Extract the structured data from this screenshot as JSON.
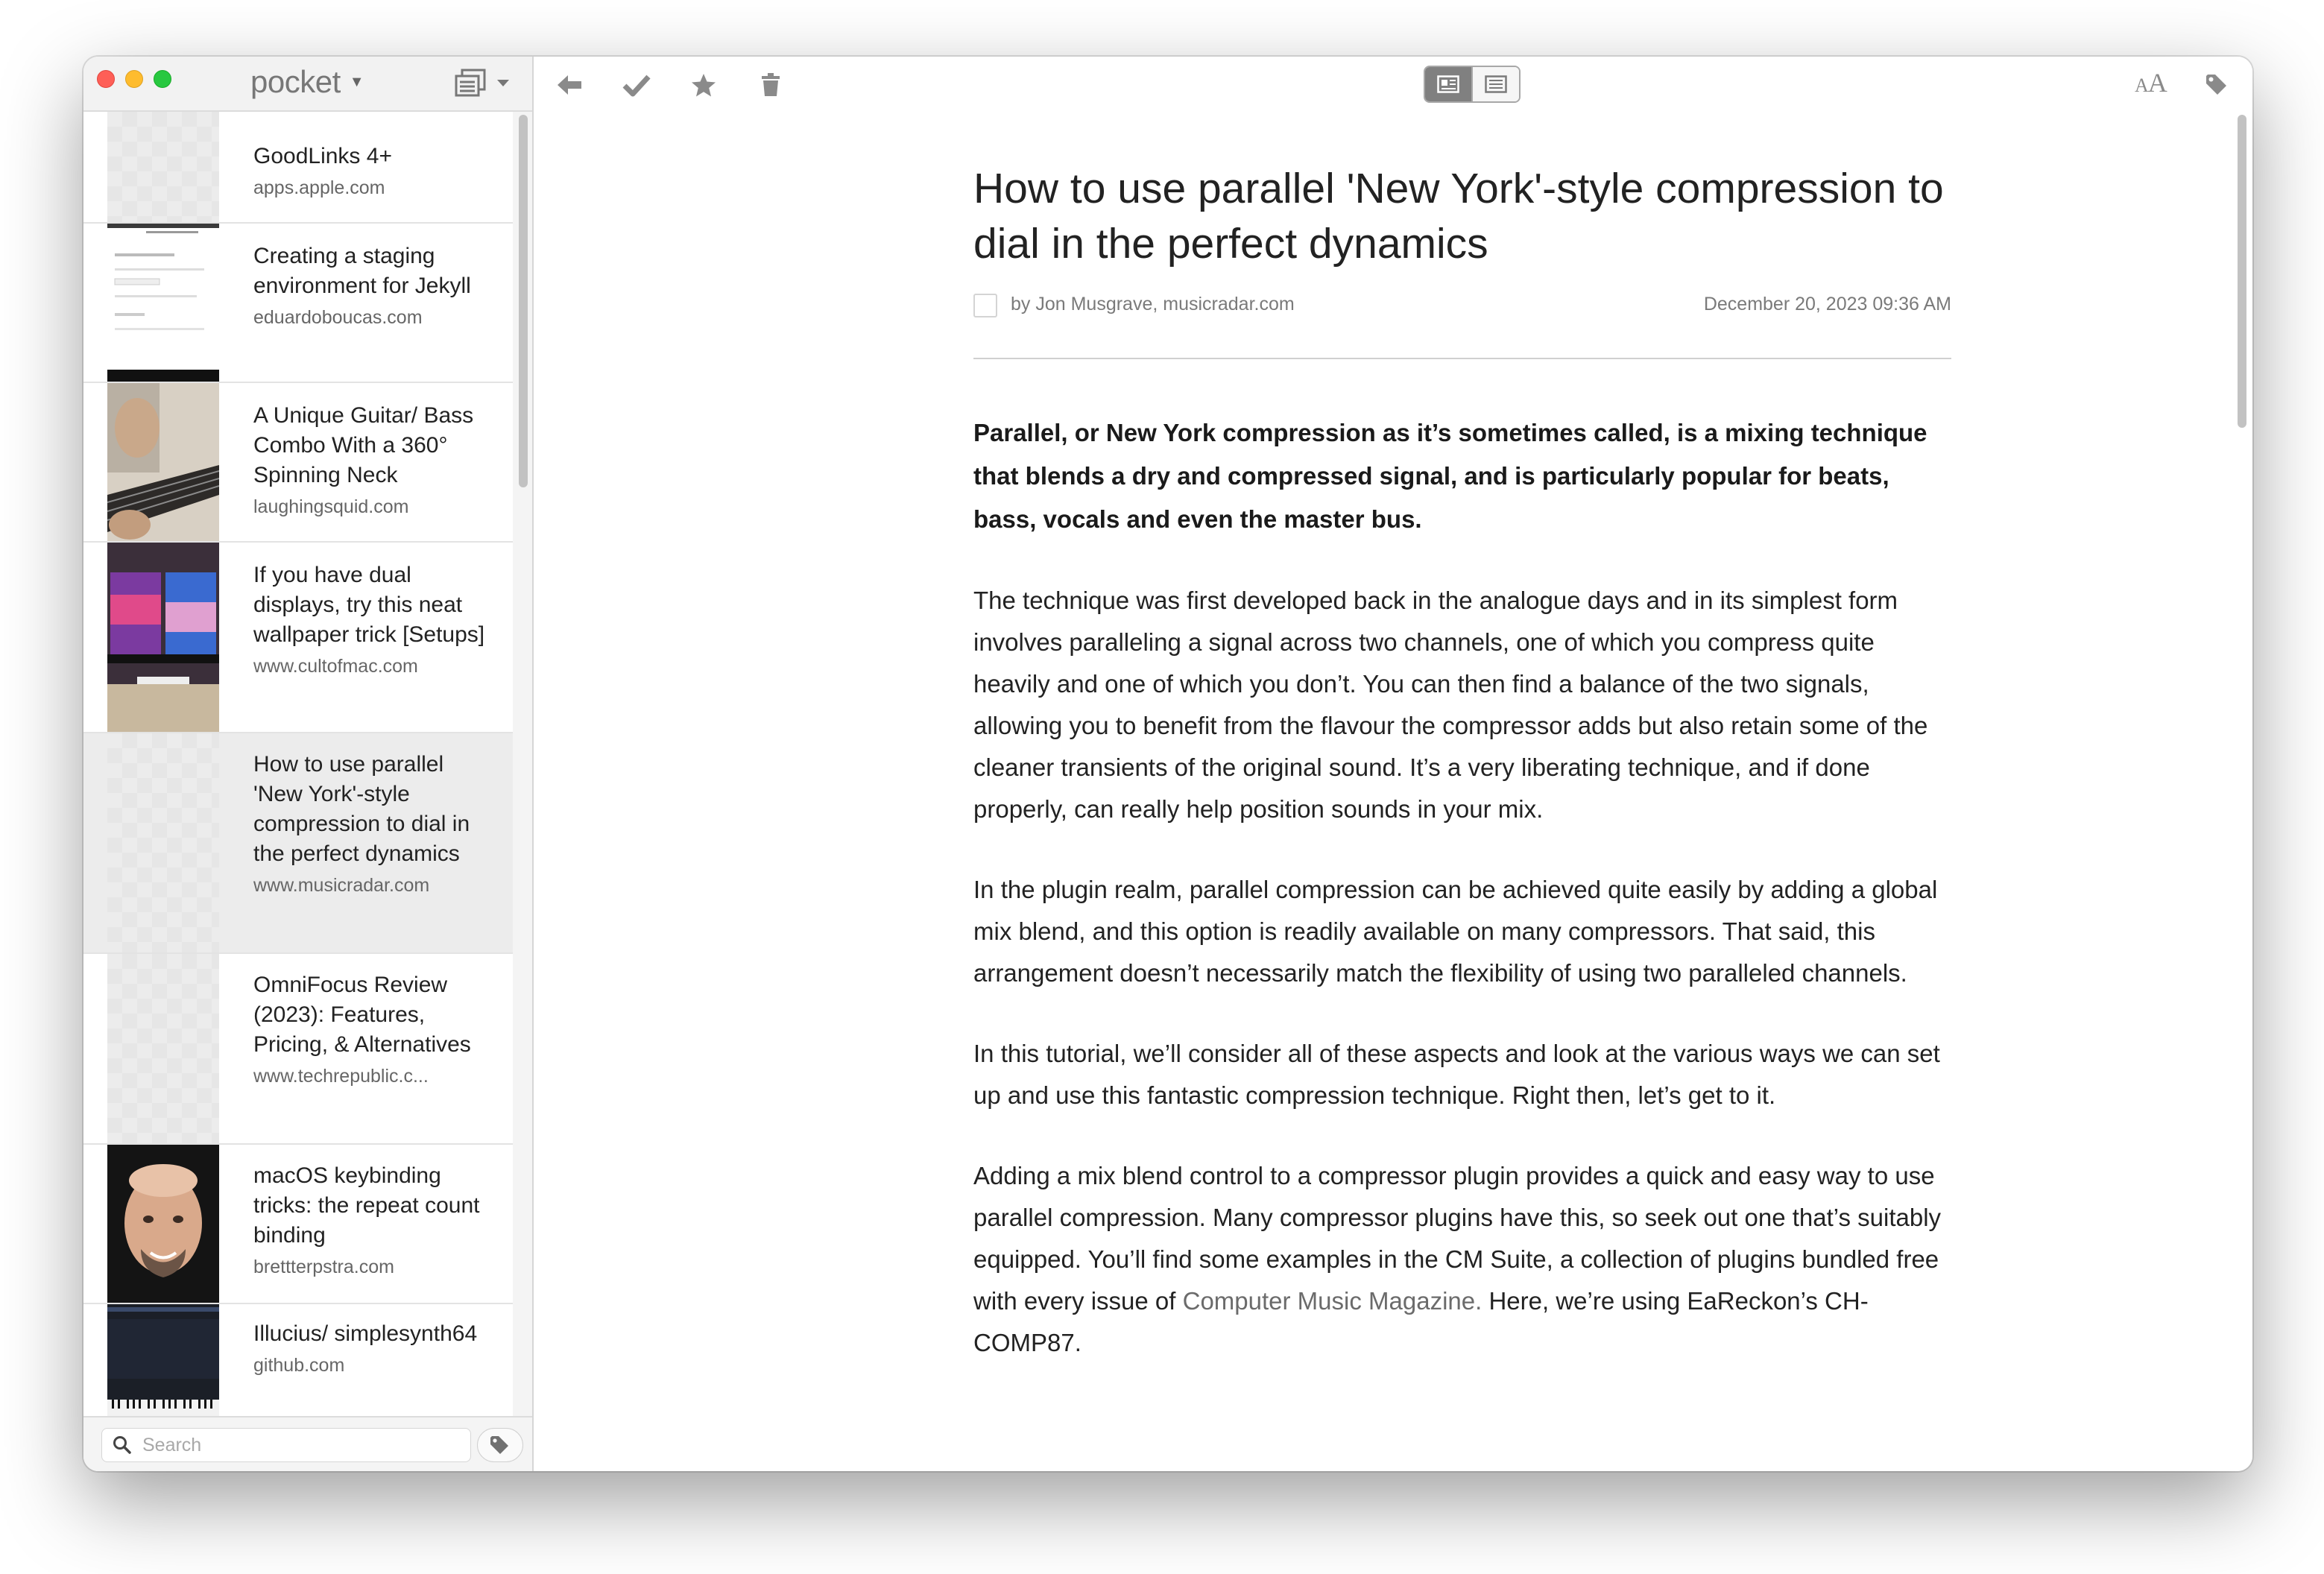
{
  "app": {
    "brand": "pocket"
  },
  "sidebar": {
    "items": [
      {
        "title": "GoodLinks 4+",
        "domain": "apps.apple.com",
        "thumb": "placeholder"
      },
      {
        "title": "Creating a staging environment for Jekyll",
        "domain": "eduardoboucas.com",
        "thumb": "web-page-screenshot"
      },
      {
        "title": "A Unique Guitar/ Bass Combo With a 360° Spinning Neck",
        "domain": "laughingsquid.com",
        "thumb": "guitar-photo"
      },
      {
        "title": "If you have dual displays, try this neat wallpaper trick [Setups]",
        "domain": "www.cultofmac.com",
        "thumb": "dual-displays-photo"
      },
      {
        "title": "How to use parallel 'New York'-style compression to dial in the perfect dynamics",
        "domain": "www.musicradar.com",
        "thumb": "placeholder",
        "selected": true
      },
      {
        "title": "OmniFocus Review (2023): Features, Pricing, & Alternatives",
        "domain": "www.techrepublic.c...",
        "thumb": "placeholder"
      },
      {
        "title": "macOS keybinding tricks: the repeat count binding",
        "domain": "brettterpstra.com",
        "thumb": "portrait-photo"
      },
      {
        "title": "Illucius/ simplesynth64",
        "domain": "github.com",
        "thumb": "synth-screenshot"
      }
    ],
    "search": {
      "placeholder": "Search",
      "value": ""
    }
  },
  "toolbar": {
    "view_modes": [
      "article-view",
      "web-view"
    ],
    "active_view": "article-view",
    "text_settings_label": "AA"
  },
  "article": {
    "title": "How to use parallel 'New York'-style compression to dial in the perfect dynamics",
    "byline": "by Jon Musgrave, musicradar.com",
    "date": "December 20, 2023 09:36 AM",
    "lead": "Parallel, or New York compression as it’s sometimes called, is a mixing technique that blends a dry and compressed signal, and is particularly popular for beats, bass, vocals and even the master bus.",
    "paragraphs": [
      "The technique was first developed back in the analogue days and in its simplest form involves paralleling a signal across two channels, one of which you compress quite heavily and one of which you don’t. You can then find a balance of the two signals, allowing you to benefit from the flavour the compressor adds but also retain some of the cleaner transients of the original sound. It’s a very liberating technique, and if done properly, can really help position sounds in your mix.",
      "In the plugin realm, parallel compression can be achieved quite easily by adding a global mix blend, and this option is readily available on many compressors. That said, this arrangement doesn’t necessarily match the flexibility of using two paralleled channels.",
      "In this tutorial, we’ll consider all of these aspects and look at the various ways we can set up and use this fantastic compression technique. Right then, let’s get to it."
    ],
    "last_paragraph": {
      "before_link": "Adding a mix blend control to a compressor plugin provides a quick and easy way to use parallel compression. Many compressor plugins have this, so seek out one that’s suitably equipped. You’ll find some examples in the CM Suite, a collection of plugins bundled free with every issue of ",
      "link": "Computer Music Magazine.",
      "after_link": " Here, we’re using EaReckon’s CH-COMP87."
    }
  },
  "colors": {
    "traffic_red": "#fe5f57",
    "traffic_yellow": "#febc2e",
    "traffic_green": "#28c840",
    "icon_gray": "#8a8a8a",
    "selected_row": "#ececec"
  }
}
